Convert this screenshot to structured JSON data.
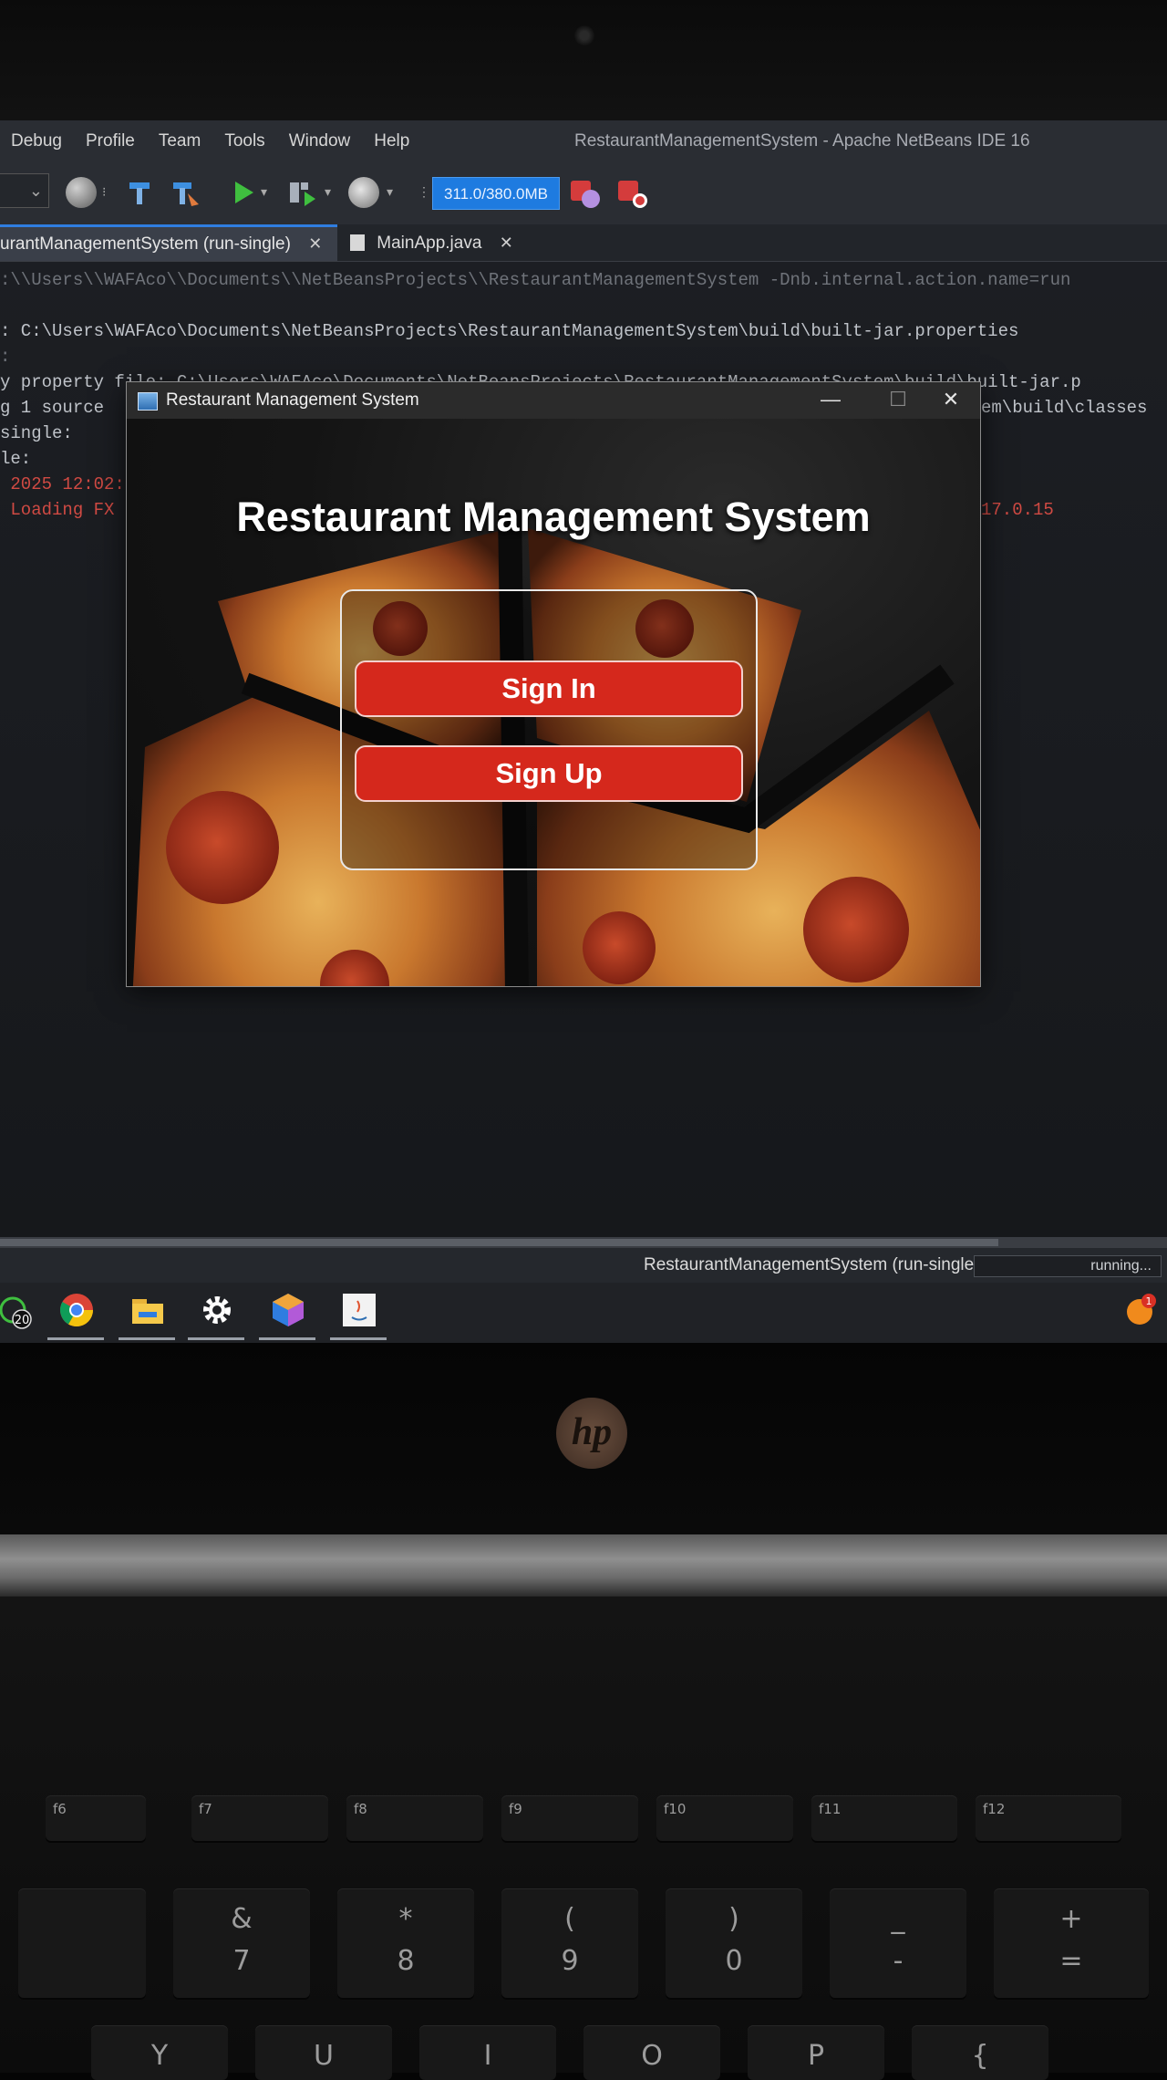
{
  "ide": {
    "menus": [
      "Debug",
      "Profile",
      "Team",
      "Tools",
      "Window",
      "Help"
    ],
    "title": "RestaurantManagementSystem - Apache NetBeans IDE 16",
    "memory": "311.0/380.0MB",
    "tabs": [
      {
        "label": "urantManagementSystem (run-single)",
        "close": "✕",
        "active": true
      },
      {
        "label": "MainApp.java",
        "close": "✕",
        "active": false
      }
    ],
    "console_lines": [
      ":\\\\Users\\\\WAFAco\\\\Documents\\\\NetBeansProjects\\\\RestaurantManagementSystem -Dnb.internal.action.name=run",
      ": C:\\Users\\WAFAco\\Documents\\NetBeansProjects\\RestaurantManagementSystem\\build\\built-jar.properties",
      ":",
      "y property file: C:\\Users\\WAFAco\\Documents\\NetBeansProjects\\RestaurantManagementSystem\\build\\built-jar.p",
      "g 1 source",
      "single:",
      "le:",
      " 2025 12:02:",
      " Loading FX"
    ],
    "console_right": [
      "em\\build\\classes",
      "17.0.15"
    ],
    "status_text": "RestaurantManagementSystem (run-single)",
    "progress_text": "running...",
    "taskbar_badge": "20",
    "notification_badge": "1"
  },
  "app": {
    "window_title": "Restaurant Management System",
    "minimize": "—",
    "maximize": "☐",
    "close": "✕",
    "heading": "Restaurant Management System",
    "sign_in": "Sign In",
    "sign_up": "Sign Up"
  },
  "laptop": {
    "logo": "hp",
    "fn_keys": [
      "f6",
      "f7",
      "f8",
      "f9",
      "f10",
      "f11",
      "f12"
    ],
    "symbol_keys": [
      {
        "top": "&",
        "main": "7"
      },
      {
        "top": "*",
        "main": "8"
      },
      {
        "top": "(",
        "main": "9"
      },
      {
        "top": ")",
        "main": "0"
      },
      {
        "top": "_",
        "main": "-"
      },
      {
        "top": "+",
        "main": "="
      }
    ],
    "letter_keys": [
      "Y",
      "U",
      "I",
      "O",
      "P",
      "{"
    ]
  }
}
